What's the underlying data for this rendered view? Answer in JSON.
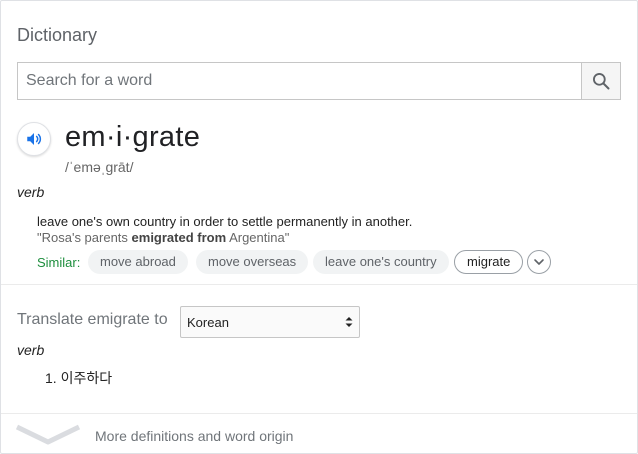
{
  "header": {
    "title": "Dictionary"
  },
  "search": {
    "placeholder": "Search for a word",
    "value": ""
  },
  "entry": {
    "word": "em·i·grate",
    "phonetic": "/ˈeməˌɡrāt/",
    "part_of_speech": "verb",
    "definition": "leave one's own country in order to settle permanently in another.",
    "example": {
      "prefix": "\"Rosa's parents ",
      "bold": "emigrated from",
      "suffix": " Argentina\""
    },
    "similar_label": "Similar:",
    "similar": [
      "move abroad",
      "move overseas",
      "leave one's country",
      "migrate"
    ]
  },
  "translate": {
    "label": "Translate emigrate to",
    "language": "Korean",
    "part_of_speech": "verb",
    "items": [
      "1. 이주하다"
    ]
  },
  "footer": {
    "more_label": "More definitions and word origin"
  },
  "colors": {
    "accent_blue": "#1a73e8",
    "similar_green": "#1e8e3e",
    "muted_text": "#70757a",
    "chip_bg": "#f1f3f4"
  },
  "icons": {
    "search": "search-icon",
    "speaker": "speaker-icon",
    "expand": "chevron-down-icon",
    "select": "up-down-arrows-icon",
    "more": "chevron-down-icon"
  }
}
